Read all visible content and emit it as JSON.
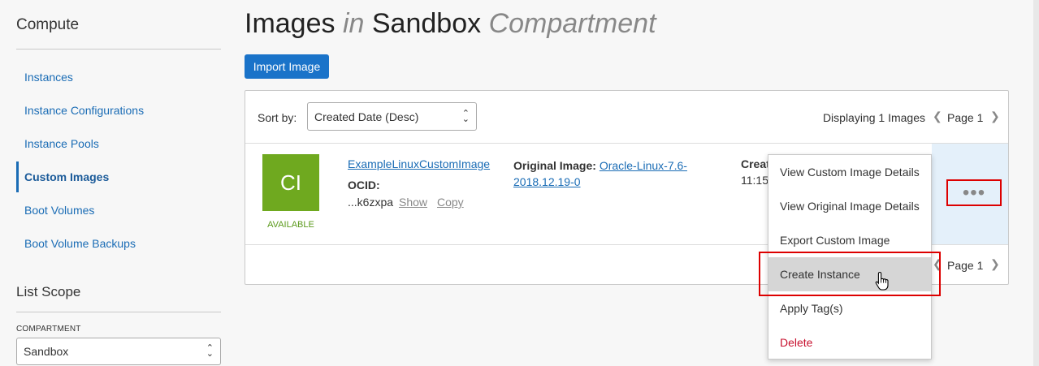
{
  "sidebar": {
    "title": "Compute",
    "items": [
      {
        "label": "Instances"
      },
      {
        "label": "Instance Configurations"
      },
      {
        "label": "Instance Pools"
      },
      {
        "label": "Custom Images"
      },
      {
        "label": "Boot Volumes"
      },
      {
        "label": "Boot Volume Backups"
      }
    ],
    "scope_title": "List Scope",
    "compartment_label": "COMPARTMENT",
    "compartment_value": "Sandbox"
  },
  "header": {
    "title_1": "Images",
    "title_in": "in",
    "title_2": "Sandbox",
    "title_3": "Compartment",
    "import_button": "Import Image"
  },
  "list": {
    "sort_label": "Sort by:",
    "sort_value": "Created Date (Desc)",
    "displaying": "Displaying 1 Images",
    "page_label": "Page 1",
    "rows": [
      {
        "tile_text": "CI",
        "status": "AVAILABLE",
        "name": "ExampleLinuxCustomImage",
        "ocid_label": "OCID:",
        "ocid_value": "...k6zxpa",
        "show": "Show",
        "copy": "Copy",
        "original_label": "Original Image:",
        "original_value": "Oracle-Linux-7.6-2018.12.19-0",
        "created_label": "Created:",
        "created_value": "11:15"
      }
    ]
  },
  "action_menu": {
    "items": [
      {
        "label": "View Custom Image Details"
      },
      {
        "label": "View Original Image Details"
      },
      {
        "label": "Export Custom Image"
      },
      {
        "label": "Create Instance"
      },
      {
        "label": "Apply Tag(s)"
      },
      {
        "label": "Delete"
      }
    ]
  },
  "colors": {
    "accent": "#1a73c9",
    "tile": "#6fa91f",
    "highlight_box": "#dd0000",
    "danger": "#c7102e"
  }
}
